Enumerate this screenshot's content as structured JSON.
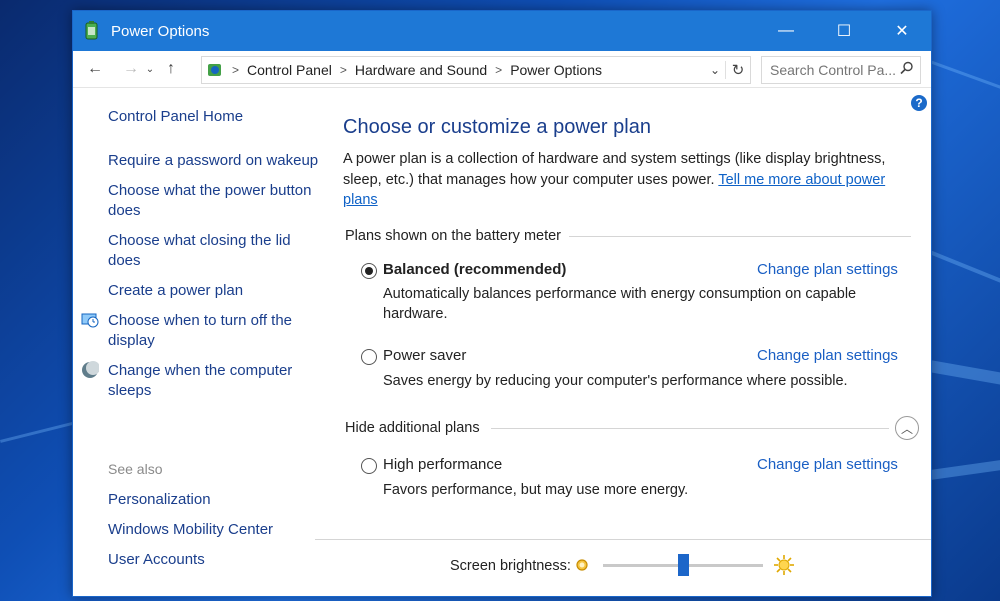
{
  "window": {
    "title": "Power Options"
  },
  "titlebar_buttons": {
    "minimize": "—",
    "maximize": "☐",
    "close": "✕"
  },
  "address": {
    "breadcrumbs": [
      "Control Panel",
      "Hardware and Sound",
      "Power Options"
    ],
    "search_placeholder": "Search Control Pa..."
  },
  "sidebar": {
    "home": "Control Panel Home",
    "links": [
      {
        "label": "Require a password on wakeup"
      },
      {
        "label": "Choose what the power button does",
        "lines": [
          "Choose what the power button",
          "does"
        ]
      },
      {
        "label": "Choose what closing the lid does",
        "lines": [
          "Choose what closing the lid",
          "does"
        ]
      },
      {
        "label": "Create a power plan"
      },
      {
        "label": "Choose when to turn off the display",
        "lines": [
          "Choose when to turn off the",
          "display"
        ],
        "icon": "monitor-clock-icon"
      },
      {
        "label": "Change when the computer sleeps",
        "lines": [
          "Change when the computer",
          "sleeps"
        ],
        "icon": "moon-icon"
      }
    ],
    "see_also_header": "See also",
    "see_also": [
      "Personalization",
      "Windows Mobility Center",
      "User Accounts"
    ]
  },
  "main": {
    "title": "Choose or customize a power plan",
    "description": "A power plan is a collection of hardware and system settings (like display brightness, sleep, etc.) that manages how your computer uses power.",
    "description_line1": "A power plan is a collection of hardware and system settings (like display brightness,",
    "description_line2": "sleep, etc.) that manages how your computer uses power.",
    "link_line1": "Tell me more about power",
    "link_line2": "plans",
    "section_battery": "Plans shown on the battery meter",
    "section_additional": "Hide additional plans",
    "change_label": "Change plan settings",
    "plans": [
      {
        "name": "Balanced (recommended)",
        "selected": true,
        "desc_line1": "Automatically balances performance with energy consumption on capable",
        "desc_line2": "hardware."
      },
      {
        "name": "Power saver",
        "selected": false,
        "desc_line1": "Saves energy by reducing your computer's performance where possible."
      },
      {
        "name": "High performance",
        "selected": false,
        "desc_line1": "Favors performance, but may use more energy."
      }
    ]
  },
  "brightness": {
    "label": "Screen brightness:",
    "level_fraction": 0.5
  },
  "colors": {
    "titlebar": "#1e78d6",
    "link": "#1a3e8c",
    "accent": "#1c66c9"
  }
}
